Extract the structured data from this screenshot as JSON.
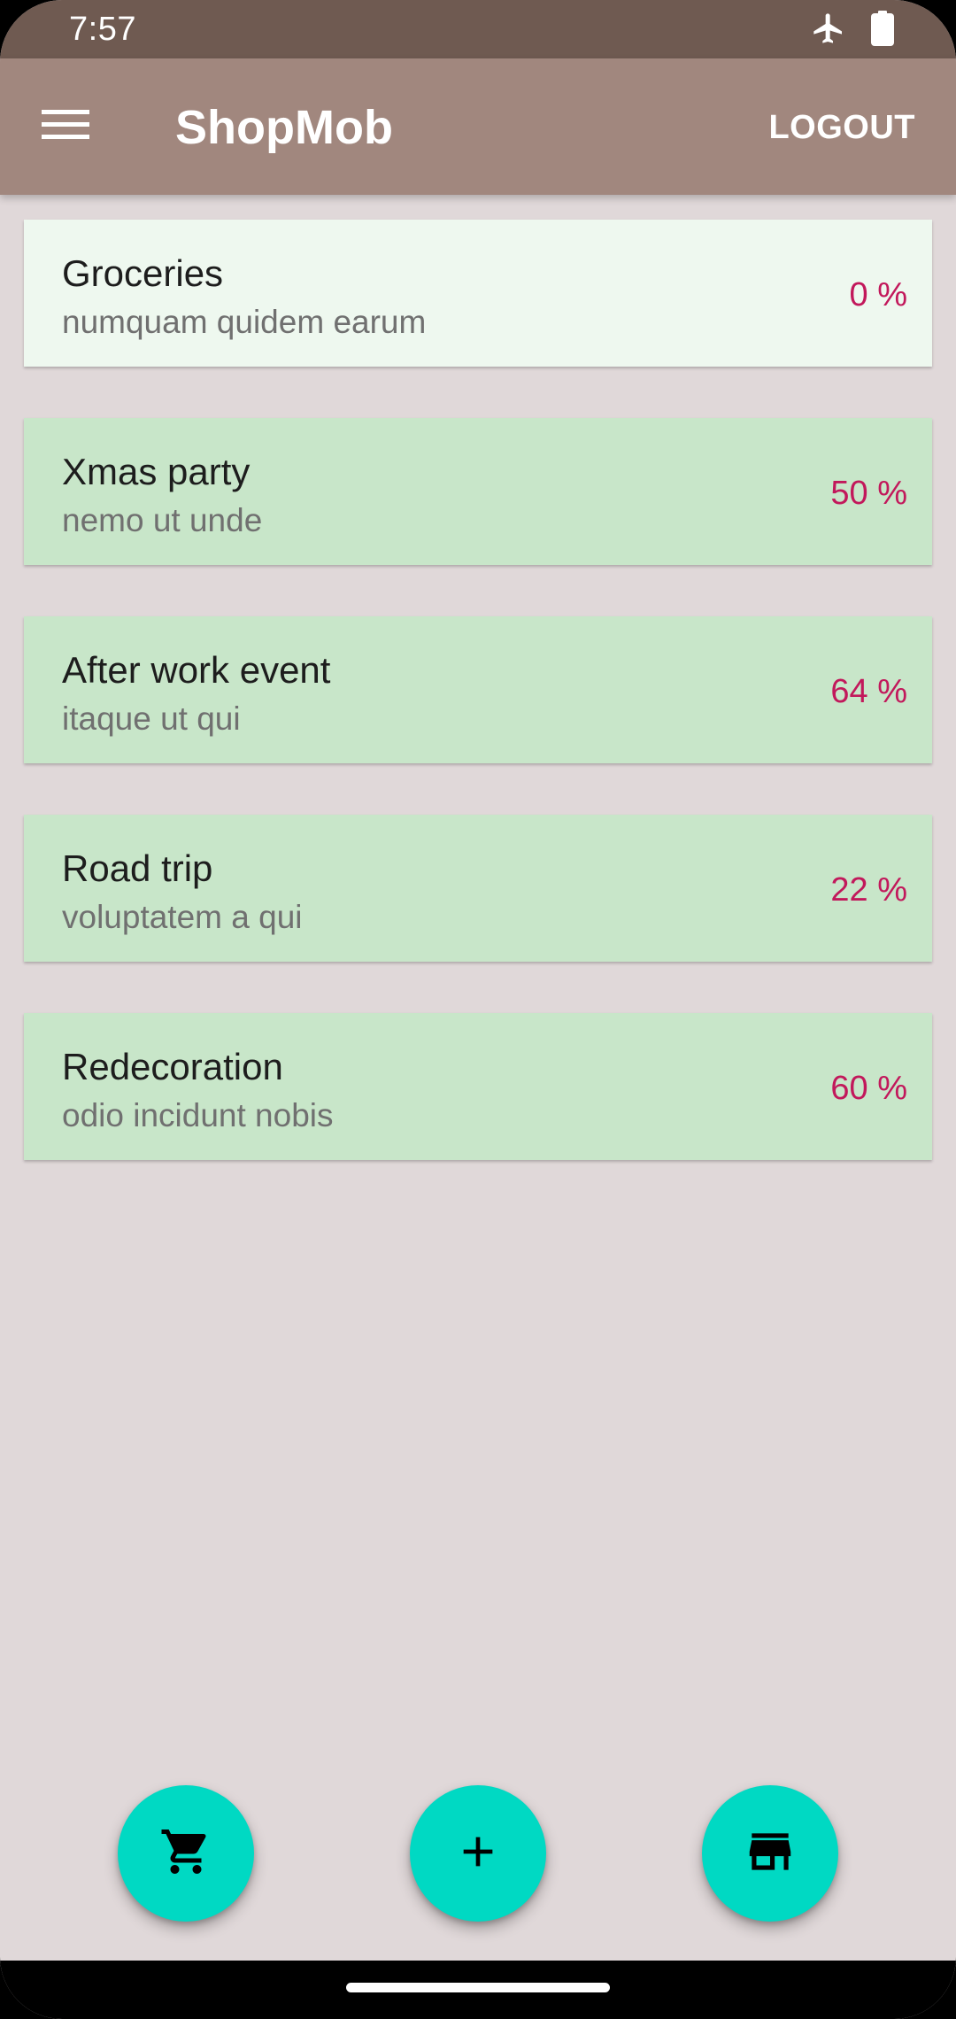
{
  "status_bar": {
    "time": "7:57",
    "icons": [
      "airplane-icon",
      "battery-icon"
    ]
  },
  "app_bar": {
    "title": "ShopMob",
    "logout_label": "LOGOUT",
    "menu_icon": "menu-icon"
  },
  "lists": [
    {
      "title": "Groceries",
      "subtitle": "numquam quidem earum",
      "progress": "0 %"
    },
    {
      "title": "Xmas party",
      "subtitle": "nemo ut unde",
      "progress": "50 %"
    },
    {
      "title": "After work event",
      "subtitle": "itaque ut qui",
      "progress": "64 %"
    },
    {
      "title": "Road trip",
      "subtitle": "voluptatem a qui",
      "progress": "22 %"
    },
    {
      "title": "Redecoration",
      "subtitle": "odio incidunt nobis",
      "progress": "60 %"
    }
  ],
  "fabs": {
    "cart_icon": "cart-icon",
    "add_icon": "add-icon",
    "store_icon": "store-icon"
  },
  "colors": {
    "status_bar": "#6f5a51",
    "app_bar": "#a1877e",
    "background": "#e0d8d9",
    "card_done": "#eef8ef",
    "card": "#c8e6c9",
    "progress_text": "#c2185b",
    "fab": "#00d9c3"
  }
}
